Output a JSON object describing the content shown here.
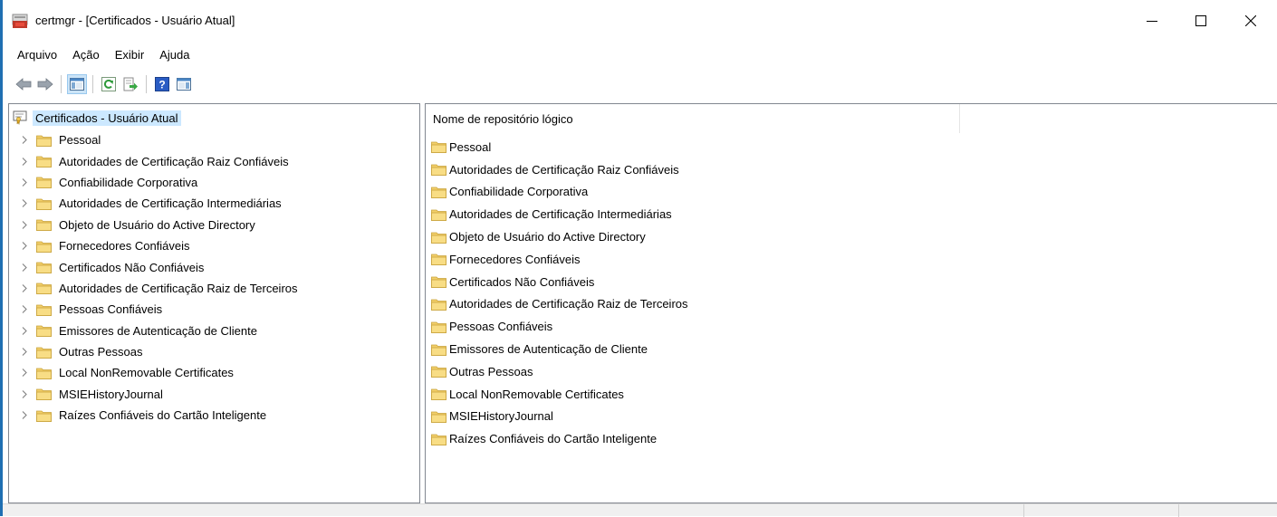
{
  "window": {
    "title": "certmgr - [Certificados - Usuário Atual]"
  },
  "menu": [
    "Arquivo",
    "Ação",
    "Exibir",
    "Ajuda"
  ],
  "toolbar": {
    "buttons": [
      "back-icon",
      "forward-icon",
      "show-hide-tree-icon",
      "refresh-icon",
      "export-list-icon",
      "help-icon",
      "properties-pane-icon"
    ]
  },
  "tree": {
    "root_label": "Certificados - Usuário Atual",
    "items": [
      "Pessoal",
      "Autoridades de Certificação Raiz Confiáveis",
      "Confiabilidade Corporativa",
      "Autoridades de Certificação Intermediárias",
      "Objeto de Usuário do Active Directory",
      "Fornecedores Confiáveis",
      "Certificados Não Confiáveis",
      "Autoridades de Certificação Raiz de Terceiros",
      "Pessoas Confiáveis",
      "Emissores de Autenticação de Cliente",
      "Outras Pessoas",
      "Local NonRemovable Certificates",
      "MSIEHistoryJournal",
      "Raízes Confiáveis do Cartão Inteligente"
    ]
  },
  "list": {
    "column_header": "Nome de repositório lógico",
    "items": [
      "Pessoal",
      "Autoridades de Certificação Raiz Confiáveis",
      "Confiabilidade Corporativa",
      "Autoridades de Certificação Intermediárias",
      "Objeto de Usuário do Active Directory",
      "Fornecedores Confiáveis",
      "Certificados Não Confiáveis",
      "Autoridades de Certificação Raiz de Terceiros",
      "Pessoas Confiáveis",
      "Emissores de Autenticação de Cliente",
      "Outras Pessoas",
      "Local NonRemovable Certificates",
      "MSIEHistoryJournal",
      "Raízes Confiáveis do Cartão Inteligente"
    ]
  },
  "colors": {
    "selection": "#cce8ff",
    "folder": "#f2cf6a",
    "accent_border": "#1f6fb2"
  }
}
